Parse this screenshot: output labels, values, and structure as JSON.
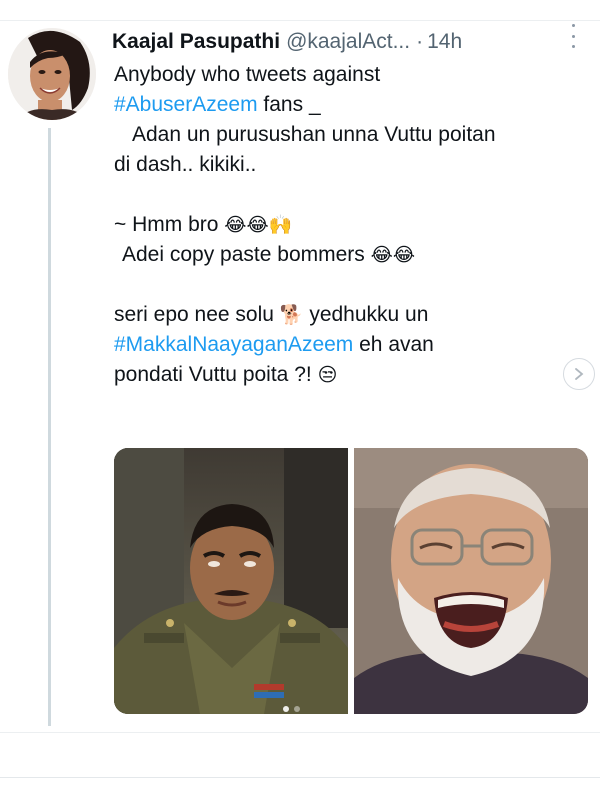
{
  "tweet": {
    "author": {
      "display_name": "Kaajal Pasupathi",
      "handle": "@kaajalAct...",
      "separator": "·",
      "time": "14h"
    },
    "text": {
      "line1": "Anybody who tweets against",
      "hashtag1": "#AbuserAzeem",
      "line2_rest": " fans _",
      "line3": "Adan un purusushan unna Vuttu poitan",
      "line4": "di dash.. kikiki..",
      "line5": "~ Hmm bro",
      "line5_emoji": "😂😂🙌",
      "line6": "Adei copy paste bommers",
      "line6_emoji": "😂😂",
      "line7_a": "seri epo nee solu",
      "line7_emoji": "🐕",
      "line7_b": "yedhukku un",
      "hashtag2": "#MakkalNaayaganAzeem",
      "line8_rest": " eh avan",
      "line9": "pondati Vuttu poita ?!",
      "line9_emoji": "😒"
    },
    "icons": {
      "more": "more-vertical-icon",
      "next": "chevron-right-icon"
    },
    "colors": {
      "hashtag": "#1d9bf0",
      "muted": "#536471",
      "text": "#0f1419"
    },
    "media": {
      "count": 2,
      "carousel_total": 2,
      "carousel_active": 1
    }
  }
}
